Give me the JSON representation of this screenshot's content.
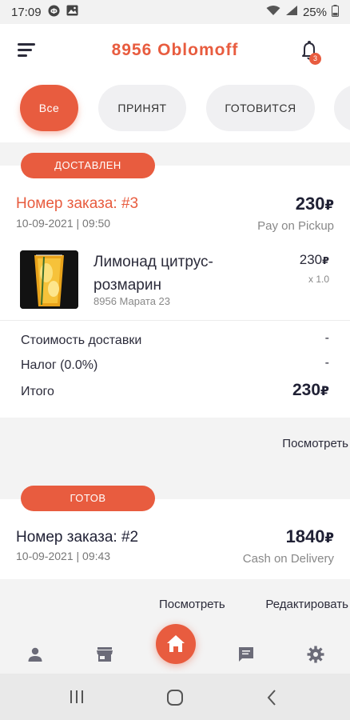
{
  "status_bar": {
    "time": "17:09",
    "battery": "25%"
  },
  "header": {
    "title": "8956 Oblomoff",
    "notification_count": "3"
  },
  "filters": [
    {
      "label": "Все",
      "active": true
    },
    {
      "label": "ПРИНЯТ",
      "active": false
    },
    {
      "label": "ГОТОВИТСЯ",
      "active": false
    }
  ],
  "orders": [
    {
      "status": "ДОСТАВЛЕН",
      "order_label": "Номер заказа: #3",
      "datetime": "10-09-2021 | 09:50",
      "total": "230",
      "payment": "Pay on Pickup",
      "item": {
        "name": "Лимонад цитрус-розмарин",
        "branch": "8956 Марата 23",
        "price": "230",
        "qty": "x 1.0"
      },
      "summary": {
        "delivery_label": "Стоимость доставки",
        "delivery_value": "-",
        "tax_label": "Налог (0.0%)",
        "tax_value": "-",
        "total_label": "Итого",
        "total_value": "230"
      },
      "view_label": "Посмотреть"
    },
    {
      "status": "ГОТОВ",
      "order_label": "Номер заказа: #2",
      "datetime": "10-09-2021 | 09:43",
      "total": "1840",
      "payment": "Cash on Delivery",
      "view_label": "Посмотреть",
      "edit_label": "Редактировать"
    }
  ],
  "currency": "₽",
  "colors": {
    "accent": "#e85c3f",
    "text": "#2b2b3a"
  },
  "bottom_nav": [
    "person-icon",
    "store-icon",
    "home-icon",
    "chat-icon",
    "settings-icon"
  ]
}
